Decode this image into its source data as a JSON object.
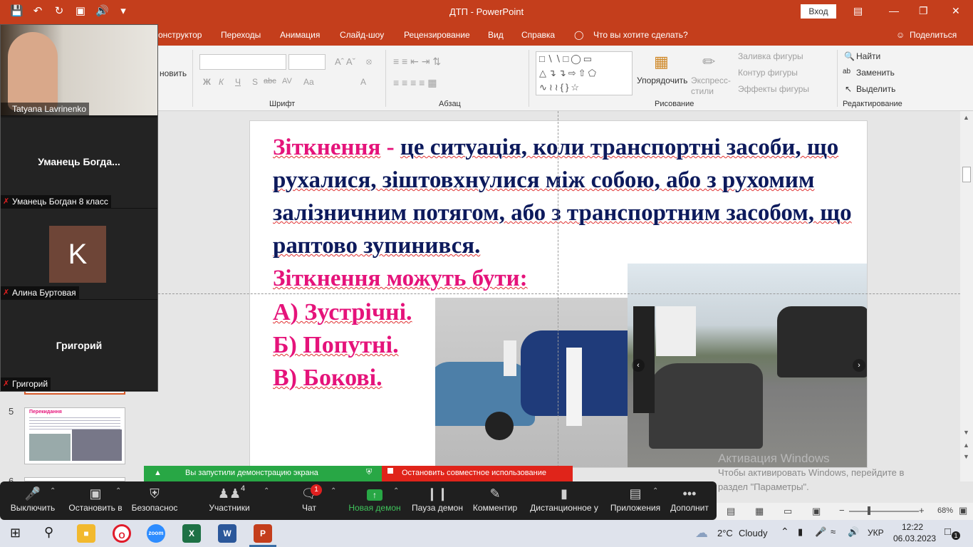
{
  "titlebar": {
    "title": "ДТП  -  PowerPoint",
    "signin": "Вход",
    "qat": [
      "save-icon",
      "undo-icon",
      "redo-icon",
      "present-icon",
      "sound-icon",
      "customize-icon"
    ]
  },
  "tabs": {
    "items": [
      "онструктор",
      "Переходы",
      "Анимация",
      "Слайд-шоу",
      "Рецензирование",
      "Вид",
      "Справка"
    ],
    "tell_me": "Что вы хотите сделать?",
    "share": "Поделиться"
  },
  "ribbon": {
    "clipboard_partial": "новить",
    "font_group": "Шрифт",
    "paragraph_group": "Абзац",
    "drawing_group": "Рисование",
    "editing_group": "Редактирование",
    "arrange": "Упорядочить",
    "express_styles": "Экспресс-стили",
    "shape_fill": "Заливка фигуры",
    "shape_outline": "Контур фигуры",
    "shape_effects": "Эффекты фигуры",
    "find": "Найти",
    "replace": "Заменить",
    "select": "Выделить",
    "font_buttons": [
      "Ж",
      "К",
      "Ч",
      "S",
      "abc",
      "AV",
      "Aa",
      "A"
    ]
  },
  "thumbnails": {
    "items": [
      {
        "num": "5",
        "title": "Перекидання"
      },
      {
        "num": "6",
        "title": ""
      }
    ]
  },
  "slide": {
    "term": "Зіткнення",
    "dash": " - ",
    "definition": "це ситуація, коли транспортні засоби, що рухалися, зіштовхнулися між собою, або з рухомим залізничним потягом, або з транспортним засобом, що раптово зупинився.",
    "types_heading": "Зіткнення можуть бути:",
    "types": [
      "А) Зустрічні.",
      "Б) Попутні.",
      "В) Бокові."
    ]
  },
  "video_panel": {
    "tiles": [
      {
        "name": "Tatyana Lavrinenko",
        "center": "",
        "type": "video"
      },
      {
        "name": "Уманець Богдан 8 класс",
        "center": "Уманець  Богда...",
        "type": "name"
      },
      {
        "name": "Алина Буртовая",
        "center": "K",
        "type": "avatar"
      },
      {
        "name": "Григорий",
        "center": "Григорий",
        "type": "name"
      }
    ]
  },
  "share_banner": {
    "status": "Вы запустили демонстрацию экрана",
    "stop": "Остановить совместное использование"
  },
  "zoom_toolbar": {
    "mute": "Выключить",
    "stop_video": "Остановить в",
    "security": "Безопаснос",
    "participants": "Участники",
    "participants_count": "4",
    "chat": "Чат",
    "chat_badge": "1",
    "new_share": "Новая демон",
    "pause_share": "Пауза демон",
    "annotate": "Комментир",
    "remote_control": "Дистанционное у",
    "apps": "Приложения",
    "more": "Дополнит"
  },
  "activation": {
    "line1": "Активация Windows",
    "line2": "Чтобы активировать Windows, перейдите в",
    "line3": "раздел \"Параметры\"."
  },
  "statusbar": {
    "zoom": "68%"
  },
  "taskbar": {
    "weather_temp": "2°C",
    "weather_text": "Cloudy",
    "lang": "УКР",
    "time": "12:22",
    "date": "06.03.2023",
    "notification_count": "1"
  },
  "colors": {
    "ppt_accent": "#c43e1c",
    "slide_text": "#0d1a5c",
    "slide_pink": "#e5137a",
    "share_green": "#28a745",
    "share_red": "#e0241a"
  }
}
